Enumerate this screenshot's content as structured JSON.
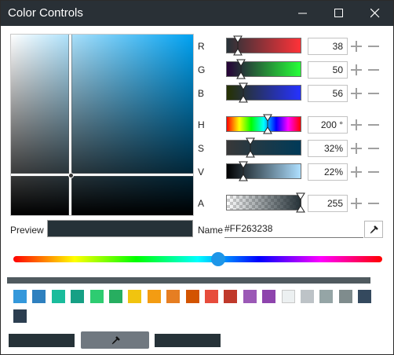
{
  "window": {
    "title": "Color Controls",
    "controls": [
      "minimize-icon",
      "maximize-icon",
      "close-icon"
    ]
  },
  "color_area": {
    "hue_color": "#00a2f2"
  },
  "channels": {
    "r": {
      "label": "R",
      "value": "38",
      "fraction": 0.149,
      "gradient": [
        "#263238",
        "#ff3238"
      ]
    },
    "g": {
      "label": "G",
      "value": "50",
      "fraction": 0.196,
      "gradient": [
        "#260038",
        "#26ff38"
      ]
    },
    "b": {
      "label": "B",
      "value": "56",
      "fraction": 0.22,
      "gradient": [
        "#263200",
        "#2632ff"
      ]
    },
    "h": {
      "label": "H",
      "value": "200 °",
      "fraction": 0.556
    },
    "s": {
      "label": "S",
      "value": "32%",
      "fraction": 0.32,
      "gradient": [
        "#383838",
        "#003a58"
      ]
    },
    "v": {
      "label": "V",
      "value": "22%",
      "fraction": 0.22,
      "gradient": [
        "#000000",
        "#aedfff"
      ]
    },
    "a": {
      "label": "A",
      "value": "255",
      "fraction": 1.0
    }
  },
  "preview": {
    "label": "Preview",
    "color": "#263238"
  },
  "name": {
    "label": "Name",
    "value": "#FF263238"
  },
  "hue_slider": {
    "fraction": 0.556,
    "knob_color": "#1e96e8"
  },
  "palette": [
    "#3498db",
    "#2e80bf",
    "#1abc9c",
    "#16a085",
    "#2ecc71",
    "#27ae60",
    "#f1c40f",
    "#f39c12",
    "#e67e22",
    "#d35400",
    "#e74c3c",
    "#c0392b",
    "#9b59b6",
    "#8e44ad",
    "#ecf0f1",
    "#bdc3c7",
    "#95a5a6",
    "#7f8c8d",
    "#34495e",
    "#2c3e50"
  ],
  "buttons": {
    "left_color": "#263238",
    "middle_color": "#707880",
    "right_color": "#263238"
  }
}
